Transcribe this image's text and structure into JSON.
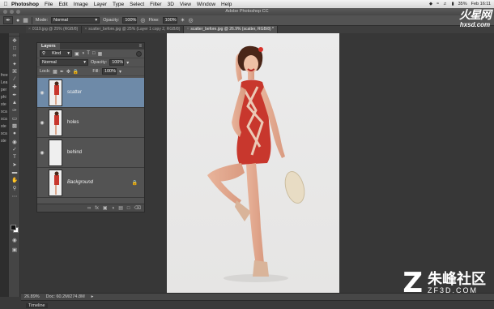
{
  "menubar": {
    "app": "Photoshop",
    "items": [
      "File",
      "Edit",
      "Image",
      "Layer",
      "Type",
      "Select",
      "Filter",
      "3D",
      "View",
      "Window",
      "Help"
    ],
    "battery": "35%",
    "clock": "Feb 16:11"
  },
  "window": {
    "title": "Adobe Photoshop CC"
  },
  "options": {
    "mode_label": "Mode:",
    "mode_value": "Normal",
    "opacity_label": "Opacity:",
    "opacity_value": "100%",
    "flow_label": "Flow:",
    "flow_value": "100%"
  },
  "tabs": [
    {
      "label": "0119.jpg @ 25% (RGB/8)",
      "active": false
    },
    {
      "label": "scatter_before.jpg @ 25% (Layer 1 copy 2, RGB/8)",
      "active": false
    },
    {
      "label": "scatter_before.jpg @ 26.9% (scatter, RGB/8) *",
      "active": true
    }
  ],
  "left_cut_text": [
    "free",
    "Lea",
    "per",
    "phi",
    "ste",
    "sca",
    "sca",
    "ste",
    "sca",
    "ste"
  ],
  "layers_panel": {
    "tab_label": "Layers",
    "kind_value": "Kind",
    "blend_value": "Normal",
    "opacity_label": "Opacity:",
    "opacity_value": "100%",
    "lock_label": "Lock:",
    "fill_label": "Fill:",
    "fill_value": "100%",
    "layers": [
      {
        "name": "scatter",
        "selected": true,
        "visible": true
      },
      {
        "name": "holes",
        "selected": false,
        "visible": true
      },
      {
        "name": "behind",
        "selected": false,
        "visible": true
      },
      {
        "name": "Background",
        "selected": false,
        "visible": false,
        "locked": true
      }
    ]
  },
  "statusbar": {
    "zoom": "26.89%",
    "doc": "Doc: 60.2M/274.8M"
  },
  "timeline_label": "Timeline",
  "watermarks": {
    "top_big": "火星网",
    "top_small": "hxsd.com",
    "bottom_cn": "朱峰社区",
    "bottom_url": "ZF3D.COM"
  },
  "colors": {
    "selected_layer": "#6e8aa8",
    "panel": "#535353",
    "dress_red": "#c8372d"
  }
}
